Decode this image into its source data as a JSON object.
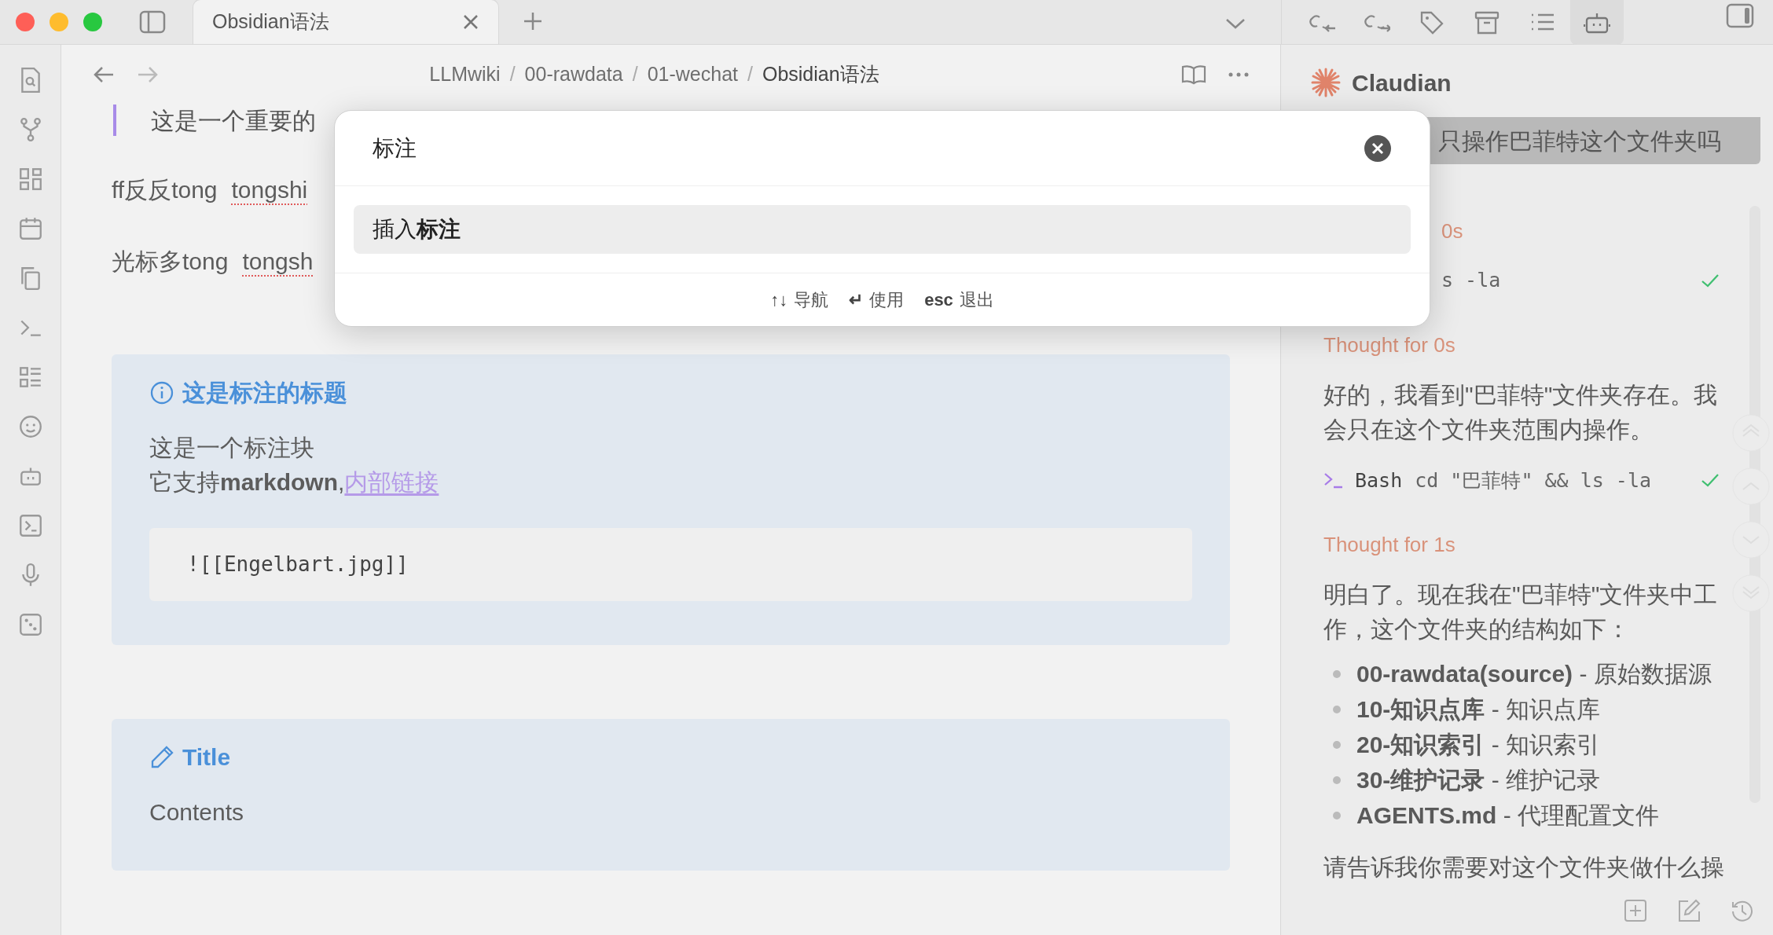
{
  "window": {
    "tabs": [
      {
        "title": "Obsidian语法",
        "selected": true
      }
    ]
  },
  "breadcrumb": [
    {
      "label": "LLMwiki"
    },
    {
      "separator": "/",
      "label": "00-rawdata"
    },
    {
      "separator": "/",
      "label": "01-wechat"
    },
    {
      "separator": "/",
      "label": "Obsidian语法"
    }
  ],
  "editor": {
    "quote_line": "这是一个重要的",
    "lines": [
      {
        "text": "ff反反tong",
        "misspelled": "tongshi"
      },
      {
        "text": "光标多tong",
        "misspelled": "tongsh"
      }
    ],
    "callouts": [
      {
        "kind": "info",
        "title": "这是标注的标题",
        "body": [
          "这是一个标注块",
          "它支持**markdown**,"
        ],
        "link": "内部链接",
        "code": "![[Engelbart.jpg]]"
      },
      {
        "kind": "edit",
        "title": "Title",
        "body": [
          "Contents"
        ]
      }
    ]
  },
  "modal": {
    "title": "标注",
    "items": [
      {
        "text": "插入**标注**",
        "selected": true
      }
    ],
    "hints": [
      {
        "key": "↑↓",
        "label": "导航"
      },
      {
        "key": "↵",
        "label": "使用"
      },
      {
        "key": "esc",
        "label": "退出"
      }
    ]
  },
  "side_panel": {
    "tabs": [
      {
        "selected": false
      },
      {
        "selected": false
      },
      {
        "selected": false
      },
      {
        "selected": false
      },
      {
        "selected": false
      },
      {
        "selected": true
      }
    ],
    "title": "Claudian",
    "user_message": "只操作巴菲特这个文件夹吗",
    "blocks": [
      {
        "kind": "thought",
        "text": "0s",
        "covered": true
      },
      {
        "kind": "tool",
        "command": "s -la",
        "done": true,
        "covered": true
      },
      {
        "kind": "thought",
        "text": "Thought for 0s",
        "covered": false
      },
      {
        "kind": "text",
        "text": "好的，我看到\"巴菲特\"文件夹存在。我会只在这个文件夹范围内操作。",
        "covered": false
      },
      {
        "kind": "tool",
        "name": "Bash",
        "command": "cd \"巴菲特\" && ls -la",
        "done": true,
        "covered": false
      },
      {
        "kind": "thought",
        "text": "Thought for 1s",
        "covered": false
      },
      {
        "kind": "text",
        "text": "明白了。现在我在\"巴菲特\"文件夹中工作，这个文件夹的结构如下：",
        "covered": false
      },
      {
        "kind": "list",
        "items": [
          "**00-rawdata(source)** - 原始数据源",
          "**10-知识点库** - 知识点库",
          "**20-知识索引** - 知识索引",
          "**30-维护记录** - 维护记录",
          "**AGENTS.md** - 代理配置文件"
        ]
      },
      {
        "kind": "text",
        "text": "请告诉我你需要对这个文件夹做什么操",
        "covered": false
      }
    ]
  }
}
